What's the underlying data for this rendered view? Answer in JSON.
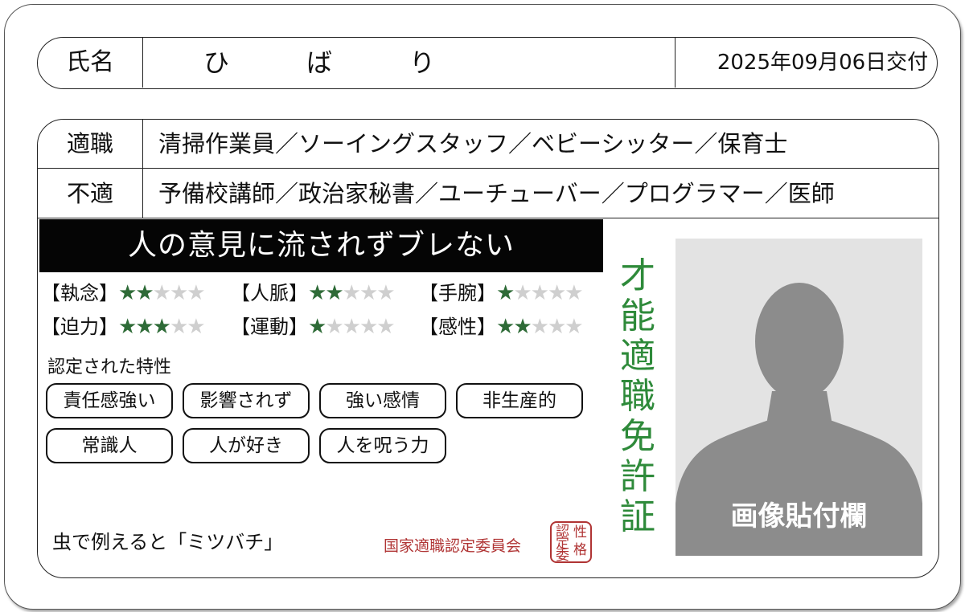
{
  "name": {
    "label": "氏名",
    "value": "ひ　　　ば　　　り"
  },
  "issue_date": "2025年09月06日交付",
  "suitable": {
    "label": "適職",
    "value": "清掃作業員／ソーイングスタッフ／ベビーシッター／保育士"
  },
  "unsuitable": {
    "label": "不適",
    "value": "予備校講師／政治家秘書／ユーチューバー／プログラマー／医師"
  },
  "headline": "人の意見に流されずブレない",
  "stats": [
    {
      "label": "【執念】",
      "rating": 2,
      "max": 5
    },
    {
      "label": "【人脈】",
      "rating": 2,
      "max": 5
    },
    {
      "label": "【手腕】",
      "rating": 1,
      "max": 5
    },
    {
      "label": "【迫力】",
      "rating": 3,
      "max": 5
    },
    {
      "label": "【運動】",
      "rating": 1,
      "max": 5
    },
    {
      "label": "【感性】",
      "rating": 2,
      "max": 5
    }
  ],
  "traits_title": "認定された特性",
  "traits": [
    "責任感強い",
    "影響されず",
    "強い感情",
    "非生産的",
    "常識人",
    "人が好き",
    "人を呪う力"
  ],
  "insect": "虫で例えると「ミツバチ」",
  "committee": "国家適職認定委員会",
  "seal": {
    "tr": "性",
    "tl": "認",
    "br": "格",
    "ml": "定",
    "bl": "委"
  },
  "license_title": "才能適職免許証",
  "photo_label": "画像貼付欄",
  "colors": {
    "star_on": "#2e6b37",
    "star_off": "#cfcfcf",
    "title_green": "#2e8a3a",
    "seal_red": "#b03434",
    "headline_bg": "#050505",
    "photo_bg": "#e3e3e3",
    "silhouette": "#8c8c8c"
  }
}
